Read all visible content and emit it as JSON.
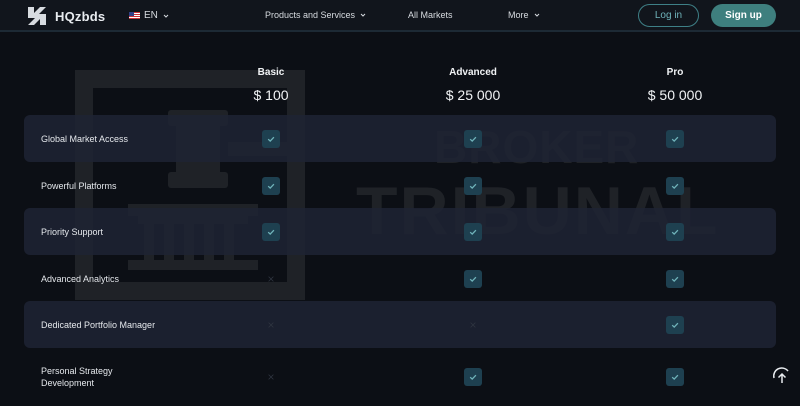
{
  "header": {
    "brand": "HQzbds",
    "language": "EN",
    "nav": [
      {
        "label": "Products and Services"
      },
      {
        "label": "All Markets"
      },
      {
        "label": "More"
      }
    ],
    "login_label": "Log in",
    "signup_label": "Sign up"
  },
  "watermark": {
    "line1": "BROKER",
    "line2": "TRIBUNAL"
  },
  "plans": [
    {
      "name": "Basic",
      "price": "$ 100"
    },
    {
      "name": "Advanced",
      "price": "$ 25 000"
    },
    {
      "name": "Pro",
      "price": "$ 50 000"
    }
  ],
  "features": [
    {
      "label": "Global Market Access",
      "included": [
        true,
        true,
        true
      ]
    },
    {
      "label": "Powerful Platforms",
      "included": [
        true,
        true,
        true
      ]
    },
    {
      "label": "Priority Support",
      "included": [
        true,
        true,
        true
      ]
    },
    {
      "label": "Advanced Analytics",
      "included": [
        false,
        true,
        true
      ]
    },
    {
      "label": "Dedicated Portfolio Manager",
      "included": [
        false,
        false,
        true
      ]
    },
    {
      "label": "Personal Strategy\nDevelopment",
      "included": [
        false,
        true,
        true
      ]
    }
  ],
  "icons": {
    "brand_logo": "logo-icon",
    "flag": "us-flag-icon",
    "dropdown": "chevron-down-icon",
    "included": "check-icon",
    "excluded": "cross-icon",
    "scroll_top": "arrow-up-icon"
  },
  "colors": {
    "accent": "#3e7f7e",
    "check_bg": "#1e4050",
    "check_mark": "#6fb3ba",
    "background": "#0c0f15"
  }
}
